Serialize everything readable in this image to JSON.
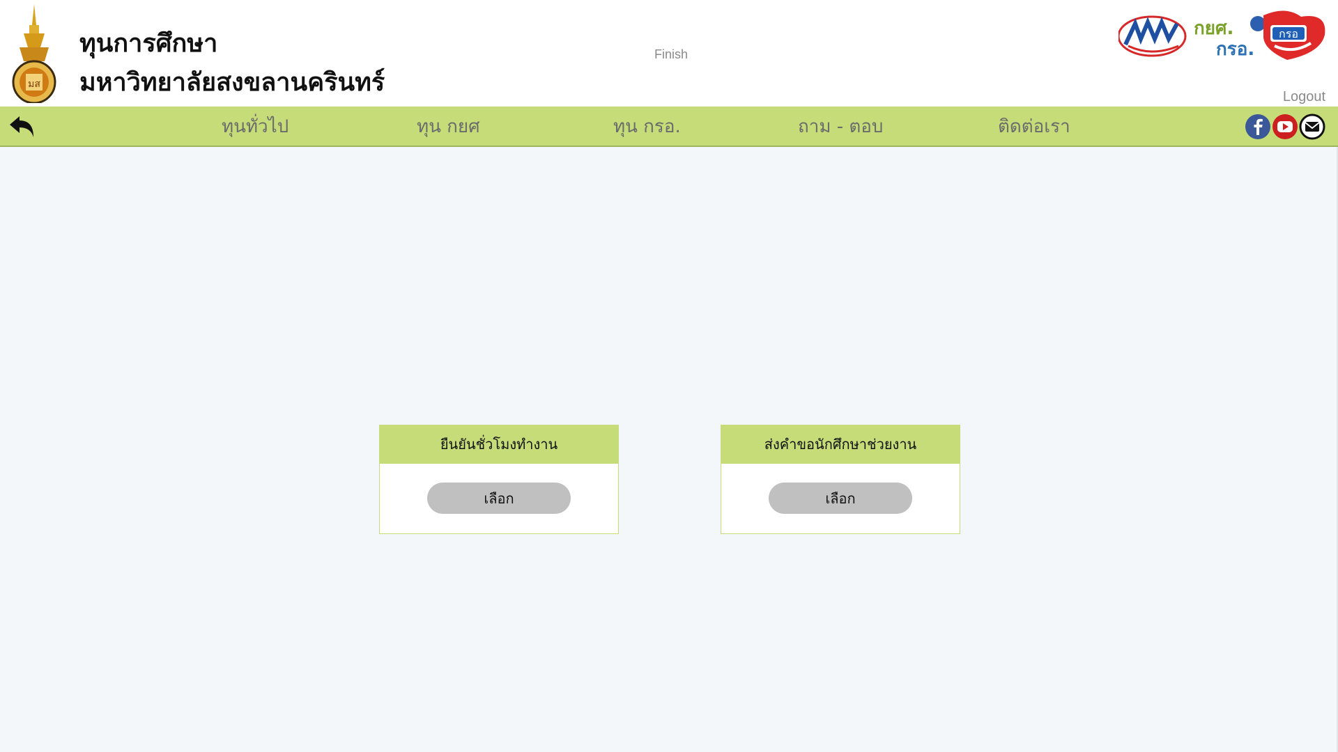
{
  "header": {
    "title_line1": "ทุนการศึกษา",
    "title_line2": "มหาวิทยาลัยสงขลานครินทร์",
    "status_text": "Finish",
    "logout_label": "Logout",
    "partner_logo_text_1": "กยศ.",
    "partner_logo_text_2": "กรอ.",
    "seal_icon": "university-seal",
    "partner_logo_icon": "slf-logo"
  },
  "nav": {
    "back_icon": "back-arrow-icon",
    "items": [
      {
        "label": "ทุนทั่วไป"
      },
      {
        "label": "ทุน กยศ"
      },
      {
        "label": "ทุน กรอ."
      },
      {
        "label": "ถาม - ตอบ"
      },
      {
        "label": "ติดต่อเรา"
      }
    ],
    "social_icons": [
      "facebook-icon",
      "youtube-icon",
      "mail-icon"
    ]
  },
  "cards": [
    {
      "title": "ยืนยันชั่วโมงทำงาน",
      "button_label": "เลือก"
    },
    {
      "title": "ส่งคำขอนักศึกษาช่วยงาน",
      "button_label": "เลือก"
    }
  ],
  "colors": {
    "nav_bg": "#c6dc79",
    "page_bg": "#f3f7f9",
    "button_bg": "#c0c0c0",
    "facebook": "#3b5998",
    "youtube": "#cc1f1f"
  }
}
